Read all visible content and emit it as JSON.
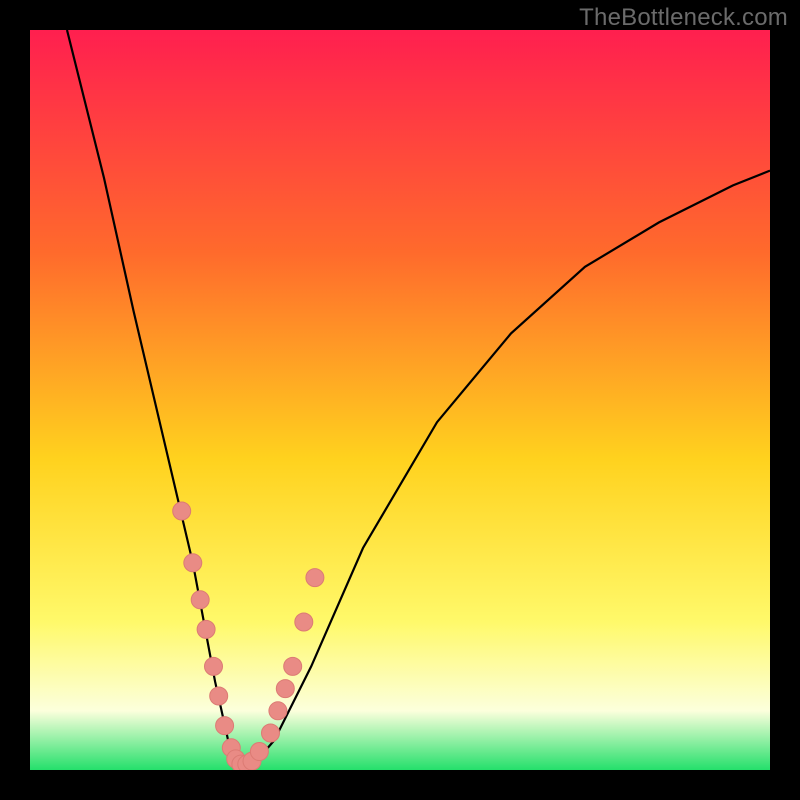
{
  "watermark": "TheBottleneck.com",
  "colors": {
    "frame": "#000000",
    "grad_top": "#ff1f4f",
    "grad_mid1": "#ff6a2c",
    "grad_mid2": "#ffd21e",
    "grad_mid3": "#fff96a",
    "grad_mid4": "#fcffdc",
    "grad_bot": "#24e06b",
    "curve": "#000000",
    "dot_fill": "#e98b85",
    "dot_stroke": "#dc7b74"
  },
  "chart_data": {
    "type": "line",
    "title": "",
    "xlabel": "",
    "ylabel": "",
    "xlim": [
      0,
      100
    ],
    "ylim": [
      0,
      100
    ],
    "series": [
      {
        "name": "bottleneck-curve",
        "x": [
          5,
          10,
          14,
          18,
          22,
          25,
          27,
          28.5,
          30,
          33,
          38,
          45,
          55,
          65,
          75,
          85,
          95,
          100
        ],
        "y": [
          100,
          80,
          62,
          45,
          28,
          12,
          3,
          0.5,
          0.5,
          4,
          14,
          30,
          47,
          59,
          68,
          74,
          79,
          81
        ]
      }
    ],
    "scatter": [
      {
        "name": "highlight-dots",
        "x": [
          20.5,
          22,
          23,
          23.8,
          24.8,
          25.5,
          26.3,
          27.2,
          27.8,
          28.5,
          29.3,
          30,
          31,
          32.5,
          33.5,
          34.5,
          35.5,
          37,
          38.5
        ],
        "y": [
          35,
          28,
          23,
          19,
          14,
          10,
          6,
          3,
          1.5,
          0.8,
          0.8,
          1.2,
          2.5,
          5,
          8,
          11,
          14,
          20,
          26
        ]
      }
    ]
  }
}
